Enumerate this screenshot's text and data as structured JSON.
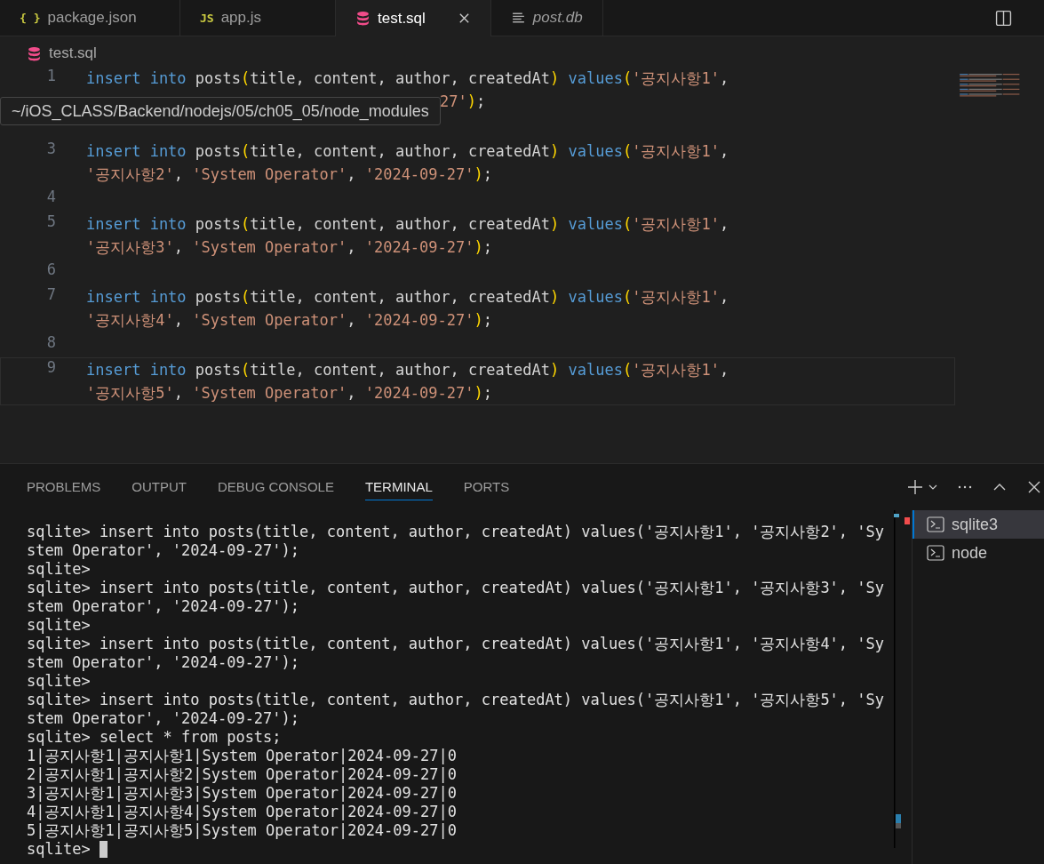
{
  "tabs": [
    {
      "kind": "json",
      "icon_text": "{ }",
      "label": "package.json",
      "selected": false,
      "preview": false
    },
    {
      "kind": "js",
      "icon_text": "JS",
      "label": "app.js",
      "selected": false,
      "preview": false
    },
    {
      "kind": "sql",
      "label": "test.sql",
      "selected": true,
      "preview": false
    },
    {
      "kind": "text",
      "label": "post.db",
      "selected": false,
      "preview": true
    }
  ],
  "breadcrumb": {
    "kind": "sql",
    "label": "test.sql"
  },
  "tooltip": "~/iOS_CLASS/Backend/nodejs/05/ch05_05/node_modules",
  "lines": [
    {
      "number": "1",
      "rows": [
        {
          "tokens": [
            {
              "kind": "kw",
              "t": "insert into"
            },
            {
              "kind": "plain",
              "t": " posts"
            },
            {
              "kind": "paren",
              "t": "("
            },
            {
              "kind": "plain",
              "t": "title, content, author, createdAt"
            },
            {
              "kind": "paren",
              "t": ") "
            },
            {
              "kind": "kw",
              "t": "values"
            },
            {
              "kind": "paren",
              "t": "("
            },
            {
              "kind": "str",
              "t": "'공지사항1'"
            },
            {
              "kind": "plain",
              "t": ","
            }
          ]
        },
        {
          "covered": true,
          "tokens": [
            {
              "kind": "str",
              "t": "27'"
            },
            {
              "kind": "paren",
              "t": ")"
            },
            {
              "kind": "plain",
              "t": ";"
            }
          ]
        }
      ]
    },
    {
      "kind": "covered"
    },
    {
      "number": "3",
      "rows": [
        {
          "tokens": [
            {
              "kind": "kw",
              "t": "insert into"
            },
            {
              "kind": "plain",
              "t": " posts"
            },
            {
              "kind": "paren",
              "t": "("
            },
            {
              "kind": "plain",
              "t": "title, content, author, createdAt"
            },
            {
              "kind": "paren",
              "t": ") "
            },
            {
              "kind": "kw",
              "t": "values"
            },
            {
              "kind": "paren",
              "t": "("
            },
            {
              "kind": "str",
              "t": "'공지사항1'"
            },
            {
              "kind": "plain",
              "t": ","
            }
          ]
        },
        {
          "tokens": [
            {
              "kind": "str",
              "t": "'공지사항2'"
            },
            {
              "kind": "plain",
              "t": ", "
            },
            {
              "kind": "str",
              "t": "'System Operator'"
            },
            {
              "kind": "plain",
              "t": ", "
            },
            {
              "kind": "str",
              "t": "'2024-09-27'"
            },
            {
              "kind": "paren",
              "t": ")"
            },
            {
              "kind": "plain",
              "t": ";"
            }
          ]
        }
      ]
    },
    {
      "number": "4"
    },
    {
      "number": "5",
      "rows": [
        {
          "tokens": [
            {
              "kind": "kw",
              "t": "insert into"
            },
            {
              "kind": "plain",
              "t": " posts"
            },
            {
              "kind": "paren",
              "t": "("
            },
            {
              "kind": "plain",
              "t": "title, content, author, createdAt"
            },
            {
              "kind": "paren",
              "t": ") "
            },
            {
              "kind": "kw",
              "t": "values"
            },
            {
              "kind": "paren",
              "t": "("
            },
            {
              "kind": "str",
              "t": "'공지사항1'"
            },
            {
              "kind": "plain",
              "t": ","
            }
          ]
        },
        {
          "tokens": [
            {
              "kind": "str",
              "t": "'공지사항3'"
            },
            {
              "kind": "plain",
              "t": ", "
            },
            {
              "kind": "str",
              "t": "'System Operator'"
            },
            {
              "kind": "plain",
              "t": ", "
            },
            {
              "kind": "str",
              "t": "'2024-09-27'"
            },
            {
              "kind": "paren",
              "t": ")"
            },
            {
              "kind": "plain",
              "t": ";"
            }
          ]
        }
      ]
    },
    {
      "number": "6"
    },
    {
      "number": "7",
      "rows": [
        {
          "tokens": [
            {
              "kind": "kw",
              "t": "insert into"
            },
            {
              "kind": "plain",
              "t": " posts"
            },
            {
              "kind": "paren",
              "t": "("
            },
            {
              "kind": "plain",
              "t": "title, content, author, createdAt"
            },
            {
              "kind": "paren",
              "t": ") "
            },
            {
              "kind": "kw",
              "t": "values"
            },
            {
              "kind": "paren",
              "t": "("
            },
            {
              "kind": "str",
              "t": "'공지사항1'"
            },
            {
              "kind": "plain",
              "t": ","
            }
          ]
        },
        {
          "tokens": [
            {
              "kind": "str",
              "t": "'공지사항4'"
            },
            {
              "kind": "plain",
              "t": ", "
            },
            {
              "kind": "str",
              "t": "'System Operator'"
            },
            {
              "kind": "plain",
              "t": ", "
            },
            {
              "kind": "str",
              "t": "'2024-09-27'"
            },
            {
              "kind": "paren",
              "t": ")"
            },
            {
              "kind": "plain",
              "t": ";"
            }
          ]
        }
      ]
    },
    {
      "number": "8"
    },
    {
      "number": "9",
      "current": true,
      "rows": [
        {
          "tokens": [
            {
              "kind": "kw",
              "t": "insert into"
            },
            {
              "kind": "plain",
              "t": " posts"
            },
            {
              "kind": "paren",
              "t": "("
            },
            {
              "kind": "plain",
              "t": "title, content, author, createdAt"
            },
            {
              "kind": "paren",
              "t": ") "
            },
            {
              "kind": "kw",
              "t": "values"
            },
            {
              "kind": "paren",
              "t": "("
            },
            {
              "kind": "str",
              "t": "'공지사항1'"
            },
            {
              "kind": "plain",
              "t": ","
            }
          ]
        },
        {
          "tokens": [
            {
              "kind": "str",
              "t": "'공지사항5'"
            },
            {
              "kind": "plain",
              "t": ", "
            },
            {
              "kind": "str",
              "t": "'System Operator'"
            },
            {
              "kind": "plain",
              "t": ", "
            },
            {
              "kind": "str",
              "t": "'2024-09-27'"
            },
            {
              "kind": "paren",
              "t": ")"
            },
            {
              "kind": "plain",
              "t": ";"
            }
          ]
        }
      ]
    }
  ],
  "panel_tabs": [
    {
      "label": "PROBLEMS",
      "selected": false
    },
    {
      "label": "OUTPUT",
      "selected": false
    },
    {
      "label": "DEBUG CONSOLE",
      "selected": false
    },
    {
      "label": "TERMINAL",
      "selected": true
    },
    {
      "label": "PORTS",
      "selected": false
    }
  ],
  "terminal": {
    "lines": [
      "sqlite> insert into posts(title, content, author, createdAt) values('공지사항1', '공지사항2', 'Sy",
      "stem Operator', '2024-09-27');",
      "sqlite>",
      "sqlite> insert into posts(title, content, author, createdAt) values('공지사항1', '공지사항3', 'Sy",
      "stem Operator', '2024-09-27');",
      "sqlite>",
      "sqlite> insert into posts(title, content, author, createdAt) values('공지사항1', '공지사항4', 'Sy",
      "stem Operator', '2024-09-27');",
      "sqlite>",
      "sqlite> insert into posts(title, content, author, createdAt) values('공지사항1', '공지사항5', 'Sy",
      "stem Operator', '2024-09-27');",
      "sqlite> select * from posts;",
      "1|공지사항1|공지사항1|System Operator|2024-09-27|0",
      "2|공지사항1|공지사항2|System Operator|2024-09-27|0",
      "3|공지사항1|공지사항3|System Operator|2024-09-27|0",
      "4|공지사항1|공지사항4|System Operator|2024-09-27|0",
      "5|공지사항1|공지사항5|System Operator|2024-09-27|0",
      "sqlite>"
    ],
    "cursor": true
  },
  "terminals": [
    {
      "name": "sqlite3",
      "selected": true
    },
    {
      "name": "node",
      "selected": false
    }
  ]
}
